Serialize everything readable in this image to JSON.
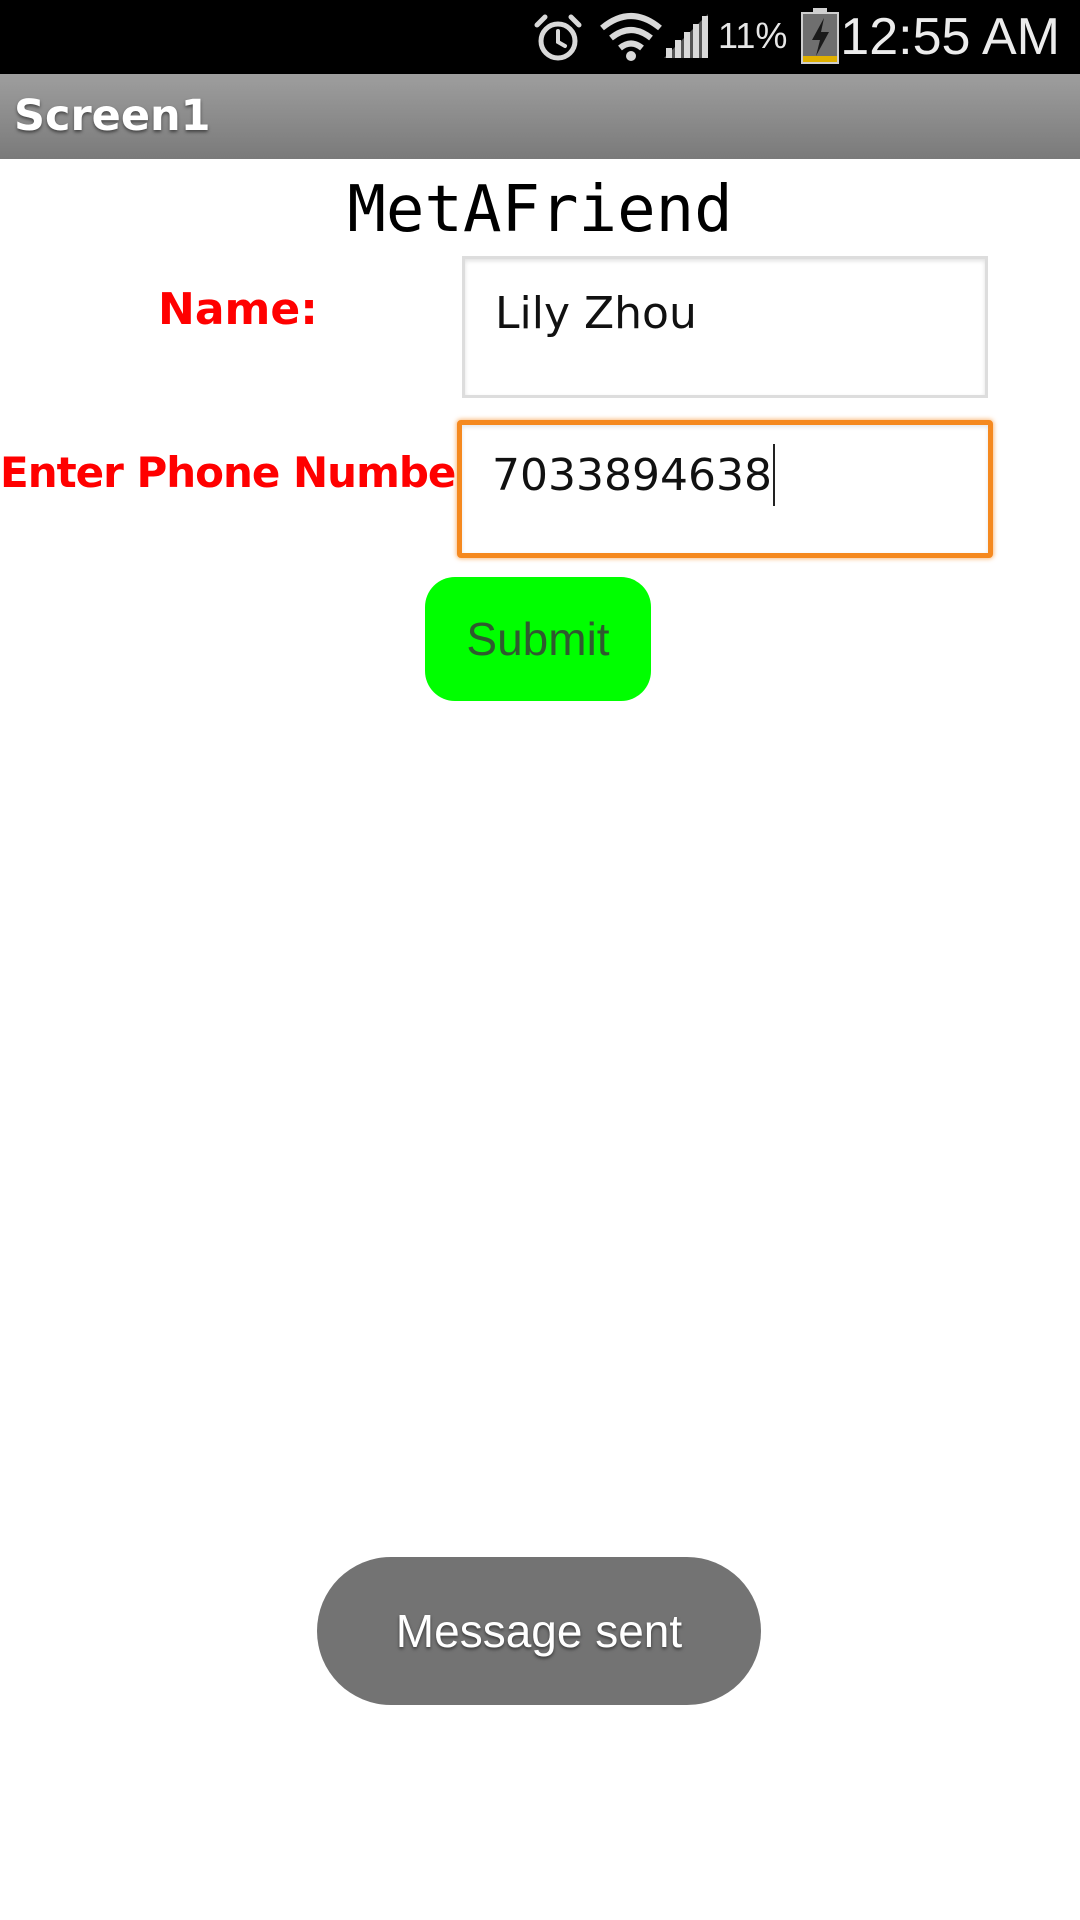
{
  "status_bar": {
    "battery_percent": "11%",
    "time": "12:55 AM",
    "icons": [
      "alarm-icon",
      "wifi-icon",
      "cell-signal-icon",
      "battery-charging-icon"
    ]
  },
  "title_bar": {
    "title": "Screen1"
  },
  "app": {
    "heading": "MetAFriend"
  },
  "form": {
    "name_label": "Name:",
    "name_value": "Lily Zhou",
    "phone_label": "Enter Phone Number:",
    "phone_value": "7033894638",
    "submit_label": "Submit"
  },
  "toast": {
    "message": "Message sent"
  },
  "colors": {
    "label": "#ff0000",
    "submit_button": "#00ff00",
    "focused_field_border": "#f5891f",
    "title_bar": "#8a8a8a",
    "toast": "#737373"
  }
}
